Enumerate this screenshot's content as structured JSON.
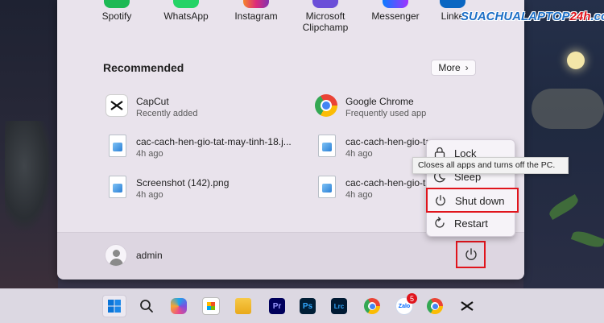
{
  "pinned_apps": [
    {
      "label": "Spotify",
      "color": "#1db954"
    },
    {
      "label": "WhatsApp",
      "color": "#25d366"
    },
    {
      "label": "Instagram",
      "color": "#e1306c"
    },
    {
      "label": "Microsoft Clipchamp",
      "color": "#6b4fd8"
    },
    {
      "label": "Messenger",
      "color": "#0a7cff"
    },
    {
      "label": "Linke",
      "color": "#0a66c2"
    }
  ],
  "recommended": {
    "title": "Recommended",
    "more_label": "More",
    "items": [
      {
        "name": "CapCut",
        "sub": "Recently added",
        "icon": "capcut-icon"
      },
      {
        "name": "Google Chrome",
        "sub": "Frequently used app",
        "icon": "chrome-icon"
      },
      {
        "name": "cac-cach-hen-gio-tat-may-tinh-18.j...",
        "sub": "4h ago",
        "icon": "image-file-icon"
      },
      {
        "name": "cac-cach-hen-gio-tat-may-tinh-17.j...",
        "sub": "4h ago",
        "icon": "image-file-icon"
      },
      {
        "name": "Screenshot (142).png",
        "sub": "4h ago",
        "icon": "image-file-icon"
      },
      {
        "name": "cac-cach-hen-gio-tat-may-tinh-16.j...",
        "sub": "4h ago",
        "icon": "image-file-icon"
      }
    ]
  },
  "user": {
    "name": "admin"
  },
  "power_menu": {
    "items": [
      {
        "label": "Lock",
        "icon": "lock-icon"
      },
      {
        "label": "Sleep",
        "icon": "sleep-icon"
      },
      {
        "label": "Shut down",
        "icon": "power-icon"
      },
      {
        "label": "Restart",
        "icon": "restart-icon"
      }
    ],
    "tooltip": "Closes all apps and turns off the PC."
  },
  "taskbar": {
    "apps": [
      "start",
      "search",
      "copilot",
      "store",
      "file-explorer",
      "premiere-pro",
      "photoshop",
      "lightroom-classic",
      "chrome",
      "zalo",
      "chrome-profile",
      "capcut"
    ],
    "ps_label": "Ps",
    "pr_label": "Pr",
    "lrc_label": "Lrc",
    "zalo_label": "Zalo",
    "zalo_badge": "5"
  },
  "watermark": {
    "text_main": "SUACHUALAPTOP",
    "text_accent": "24h",
    "text_tail": ".com"
  },
  "colors": {
    "highlight": "#e0141c",
    "accent": "#0067c0",
    "menu_bg": "#e9e3ec"
  }
}
